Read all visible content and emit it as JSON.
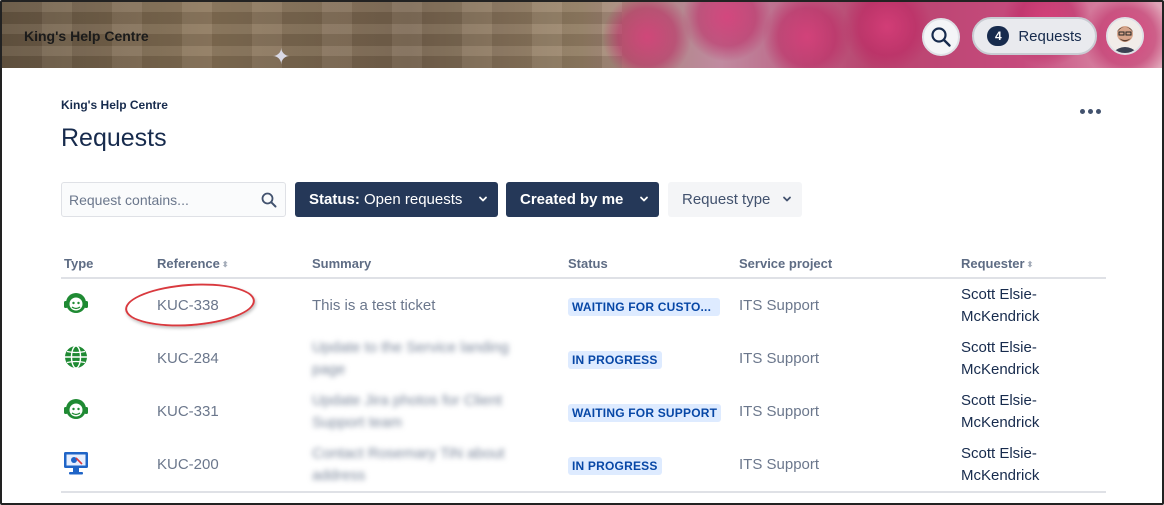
{
  "header": {
    "site_name": "King's Help Centre",
    "requests_count": "4",
    "requests_label": "Requests"
  },
  "page": {
    "breadcrumb": "King's Help Centre",
    "title": "Requests"
  },
  "filters": {
    "search_placeholder": "Request contains...",
    "status_prefix": "Status:",
    "status_value": "Open requests",
    "created_by": "Created by me",
    "request_type": "Request type"
  },
  "table": {
    "columns": [
      "Type",
      "Reference",
      "Summary",
      "Status",
      "Service project",
      "Requester"
    ],
    "rows": [
      {
        "type_icon": "agent-icon",
        "reference": "KUC-338",
        "summary": "This is a test ticket",
        "status": "WAITING FOR CUSTO...",
        "project": "ITS Support",
        "requester": "Scott Elsie-McKendrick"
      },
      {
        "type_icon": "globe-icon",
        "reference": "KUC-284",
        "summary": "Update to the Service landing page",
        "status": "IN PROGRESS",
        "project": "ITS Support",
        "requester": "Scott Elsie-McKendrick"
      },
      {
        "type_icon": "agent-icon",
        "reference": "KUC-331",
        "summary": "Update Jira photos for Client Support team",
        "status": "WAITING FOR SUPPORT",
        "project": "ITS Support",
        "requester": "Scott Elsie-McKendrick"
      },
      {
        "type_icon": "monitor-icon",
        "reference": "KUC-200",
        "summary": "Contact Rosemary TiN about address",
        "status": "IN PROGRESS",
        "project": "ITS Support",
        "requester": "Scott Elsie-McKendrick"
      }
    ]
  },
  "colors": {
    "header_dark": "#253858",
    "status_blue": "#0747a6",
    "status_bg": "#deebff",
    "icon_green": "#1f8a33",
    "annotation_red": "#d9393e"
  }
}
